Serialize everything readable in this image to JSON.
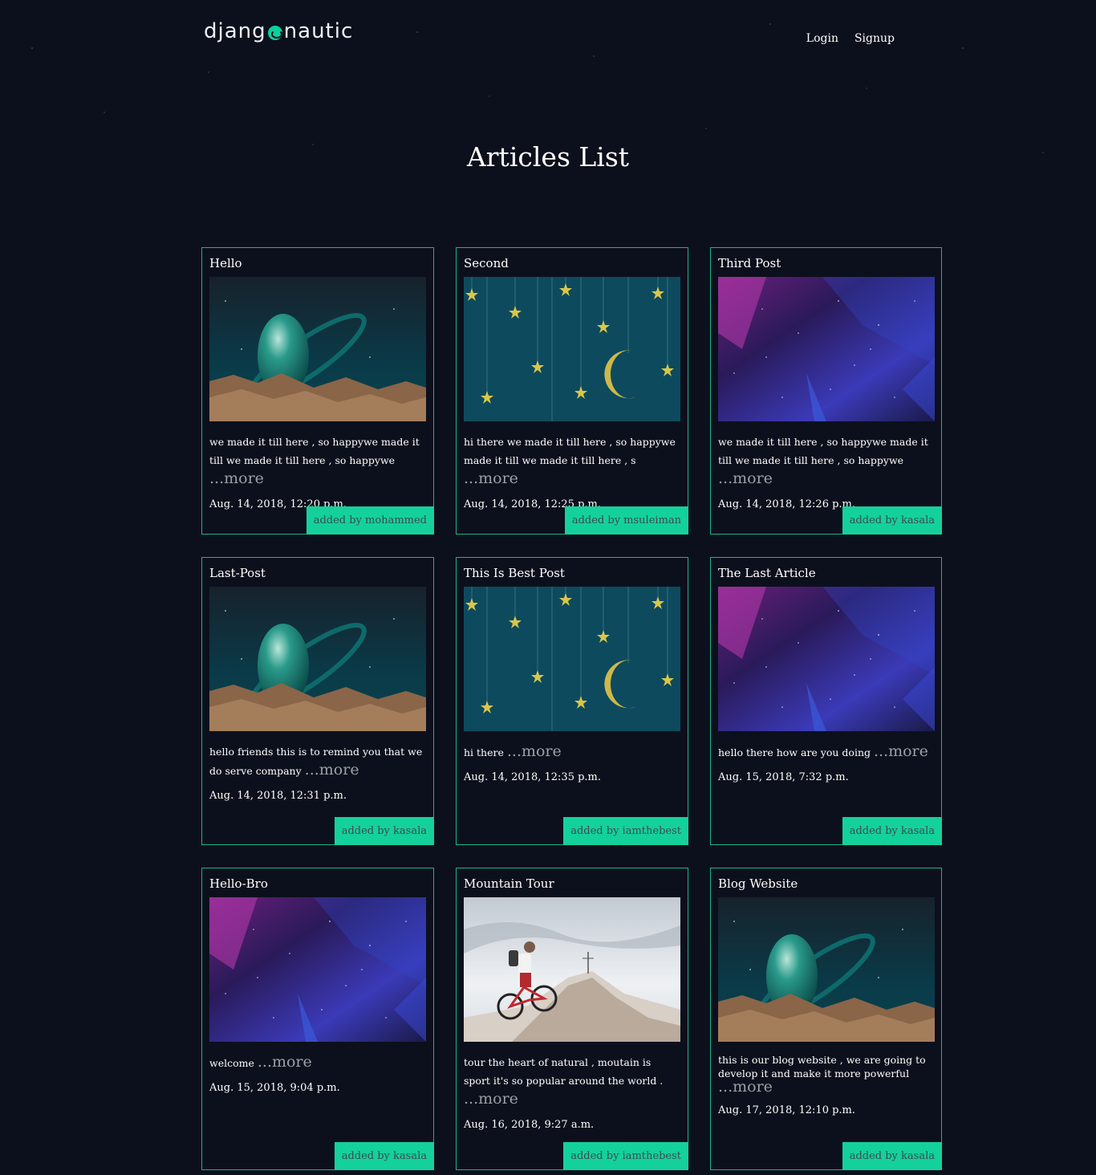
{
  "header": {
    "logo_left": "djang",
    "logo_right": "nautic",
    "nav": {
      "login": "Login",
      "signup": "Signup"
    }
  },
  "page_title": "Articles List",
  "more_label": "...more",
  "articles": [
    {
      "title": "Hello",
      "image": "planet",
      "excerpt": "we made it till here , so happywe made it till we made it till here , so happywe",
      "date": "Aug. 14, 2018, 12:20 p.m.",
      "author": "added by mohammed"
    },
    {
      "title": "Second",
      "image": "stars-moon",
      "excerpt": "hi there we made it till here , so happywe made it till we made it till here , s",
      "date": "Aug. 14, 2018, 12:25 p.m.",
      "author": "added by msuleiman"
    },
    {
      "title": "Third Post",
      "image": "galaxy",
      "excerpt": "we made it till here , so happywe made it till we made it till here , so happywe",
      "date": "Aug. 14, 2018, 12:26 p.m.",
      "author": "added by kasala"
    },
    {
      "title": "Last-Post",
      "image": "planet",
      "excerpt": "hello friends this is to remind you that we do serve company",
      "date": "Aug. 14, 2018, 12:31 p.m.",
      "author": "added by kasala"
    },
    {
      "title": "This Is Best Post",
      "image": "stars-moon",
      "excerpt": "hi there",
      "date": "Aug. 14, 2018, 12:35 p.m.",
      "author": "added by iamthebest"
    },
    {
      "title": "The Last Article",
      "image": "galaxy",
      "excerpt": "hello there how are you doing",
      "date": "Aug. 15, 2018, 7:32 p.m.",
      "author": "added by kasala"
    },
    {
      "title": "Hello-Bro",
      "image": "galaxy",
      "excerpt": "welcome",
      "date": "Aug. 15, 2018, 9:04 p.m.",
      "author": "added by kasala"
    },
    {
      "title": "Mountain Tour",
      "image": "mountain-bike",
      "excerpt": "tour the heart of natural , moutain is sport it's so popular around the world .",
      "date": "Aug. 16, 2018, 9:27 a.m.",
      "author": "added by iamthebest"
    },
    {
      "title": "Blog Website",
      "image": "planet",
      "excerpt": "this is our blog website , we are going to develop it and make it more powerful",
      "date": "Aug. 17, 2018, 12:10 p.m.",
      "author": "added by kasala"
    }
  ],
  "colors": {
    "accent": "#14d19c",
    "border": "#18b48a",
    "background": "#0c101c"
  }
}
